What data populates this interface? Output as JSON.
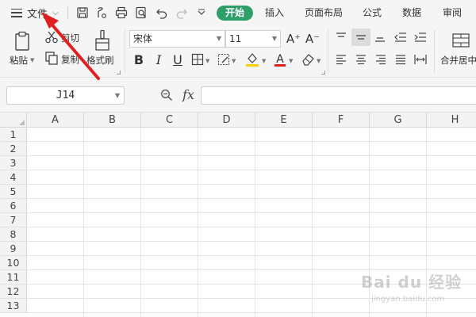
{
  "menu": {
    "file_label": "文件",
    "tabs": [
      {
        "label": "开始",
        "active": true
      },
      {
        "label": "插入",
        "active": false
      },
      {
        "label": "页面布局",
        "active": false
      },
      {
        "label": "公式",
        "active": false
      },
      {
        "label": "数据",
        "active": false
      },
      {
        "label": "审阅",
        "active": false
      }
    ],
    "quick_access_icons": [
      "save-icon",
      "format-painter-icon",
      "print-icon",
      "print-preview-icon",
      "undo-icon",
      "redo-icon",
      "customize-dropdown-icon"
    ]
  },
  "ribbon": {
    "paste_label": "粘贴",
    "cut_label": "剪切",
    "copy_label": "复制",
    "format_painter_label": "格式刷",
    "font_name": "宋体",
    "font_size": "11",
    "increase_font_label": "A⁺",
    "decrease_font_label": "A⁻",
    "bold_label": "B",
    "italic_label": "I",
    "underline_label": "U",
    "font_color_label": "A",
    "merge_center_label": "合并居中",
    "fill_color": "#f7d100",
    "font_color": "#e02020"
  },
  "formula_bar": {
    "cell_ref": "J14",
    "fx_label": "fx",
    "formula": ""
  },
  "grid": {
    "columns": [
      "A",
      "B",
      "C",
      "D",
      "E",
      "F",
      "G",
      "H"
    ],
    "rows": [
      "1",
      "2",
      "3",
      "4",
      "5",
      "6",
      "7",
      "8",
      "9",
      "10",
      "11",
      "12",
      "13"
    ]
  },
  "watermark": {
    "text": "Bai du 经验",
    "subtext": "jingyan.baidu.com"
  },
  "colors": {
    "accent": "#2f9f6a",
    "annotation": "#e02020"
  }
}
